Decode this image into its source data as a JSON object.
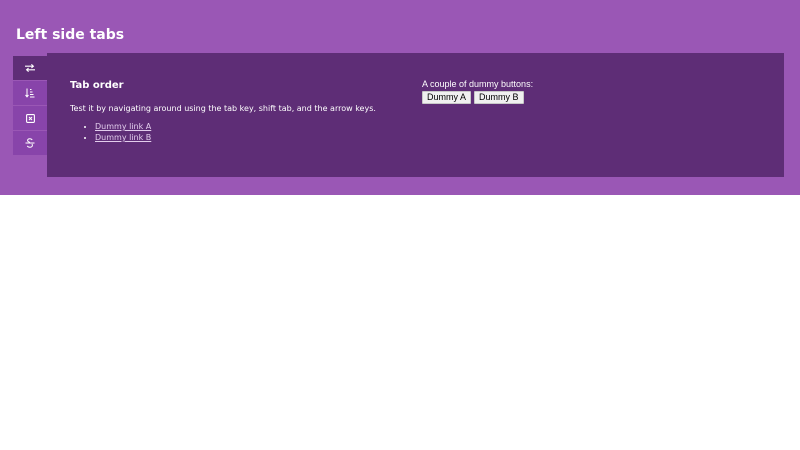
{
  "page": {
    "title": "Left side tabs"
  },
  "tabs": [
    {
      "icon": "arrows-exchange-icon",
      "active": true
    },
    {
      "icon": "sort-descending-icon",
      "active": false
    },
    {
      "icon": "square-x-icon",
      "active": false
    },
    {
      "icon": "strikethrough-icon",
      "active": false
    }
  ],
  "panel": {
    "heading": "Tab order",
    "description": "Test it by navigating around using the tab key, shift tab, and the arrow keys.",
    "links": [
      {
        "label": "Dummy link A"
      },
      {
        "label": "Dummy link B"
      }
    ],
    "buttons_label": "A couple of dummy buttons:",
    "buttons": [
      {
        "label": "Dummy A"
      },
      {
        "label": "Dummy B"
      }
    ]
  },
  "colors": {
    "banner": "#9a57b5",
    "tab": "#8844aa",
    "active_tab_and_panel": "#5e2d76",
    "link": "#e2cdec"
  }
}
